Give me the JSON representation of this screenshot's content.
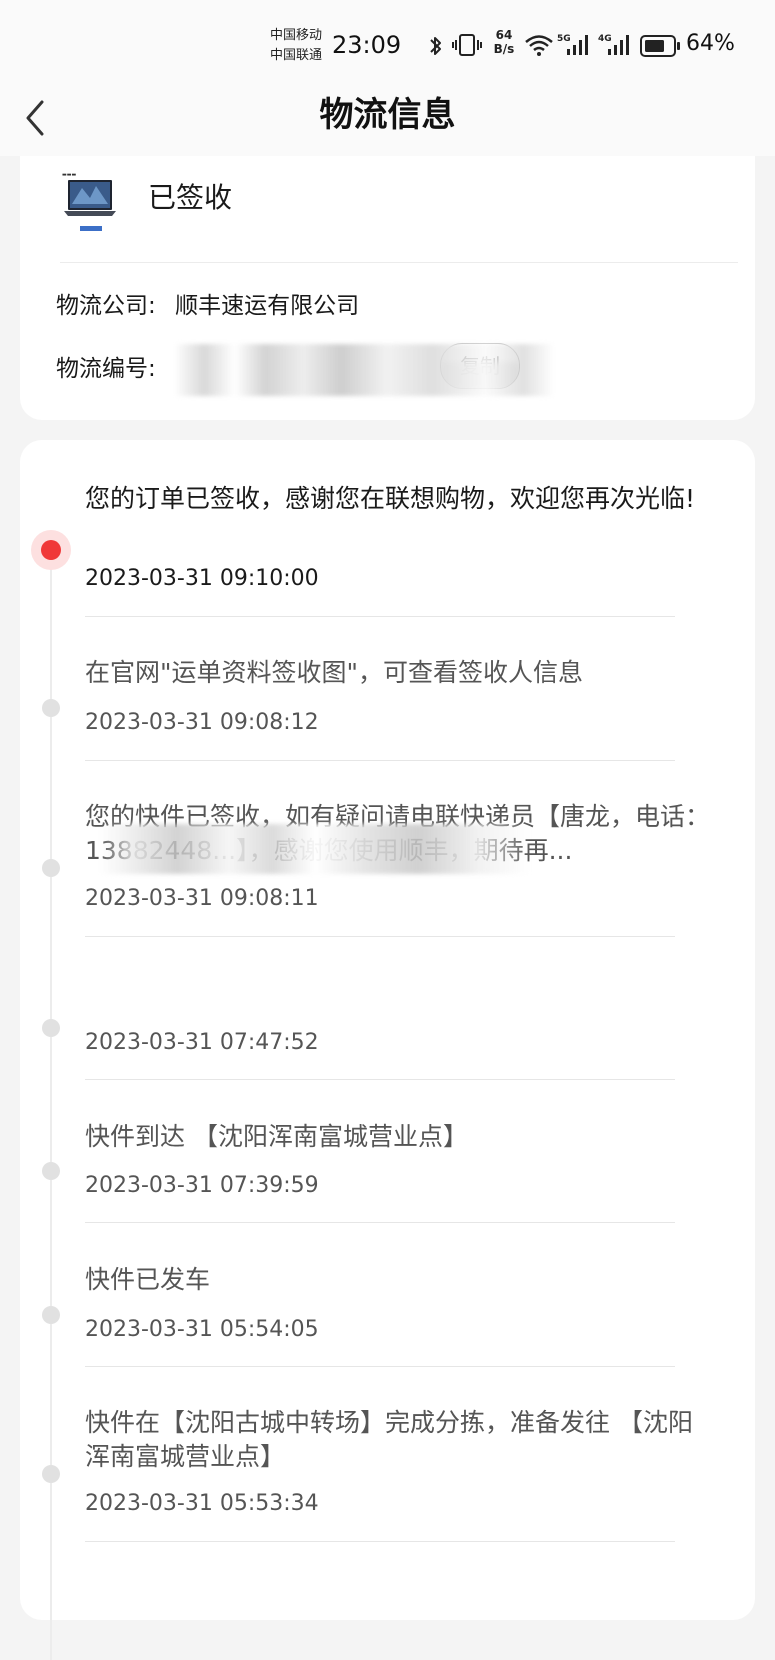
{
  "status_bar": {
    "carrier_1": "中国移动",
    "carrier_2": "中国联通",
    "time": "23:09",
    "net_speed_value": "64",
    "net_speed_unit": "B/s",
    "signal_1_label": "5G",
    "signal_2_label": "4G",
    "battery": "64%"
  },
  "header": {
    "title": "物流信息"
  },
  "order": {
    "status": "已签收",
    "company_label": "物流公司:",
    "company": "顺丰速运有限公司",
    "tracking_label": "物流编号:",
    "copy_label": "复制"
  },
  "timeline": [
    {
      "text": "您的订单已签收，感谢您在联想购物，欢迎您再次光临!",
      "time": "2023-03-31 09:10:00"
    },
    {
      "text": "在官网\"运单资料签收图\"，可查看签收人信息",
      "time": "2023-03-31 09:08:12"
    },
    {
      "text": "您的快件已签收，如有疑问请电联快递员【唐龙，电话：13882448...】，感谢您使用顺丰，期待再...",
      "time": "2023-03-31 09:08:11"
    },
    {
      "text": "",
      "time": "2023-03-31 07:47:52"
    },
    {
      "text": "快件到达 【沈阳浑南富城营业点】",
      "time": "2023-03-31 07:39:59"
    },
    {
      "text": "快件已发车",
      "time": "2023-03-31 05:54:05"
    },
    {
      "text": "快件在【沈阳古城中转场】完成分拣，准备发往 【沈阳浑南富城营业点】",
      "time": "2023-03-31 05:53:34"
    }
  ],
  "colors": {
    "accent": "#f03838",
    "background": "#f4f4f4",
    "card": "#ffffff"
  }
}
